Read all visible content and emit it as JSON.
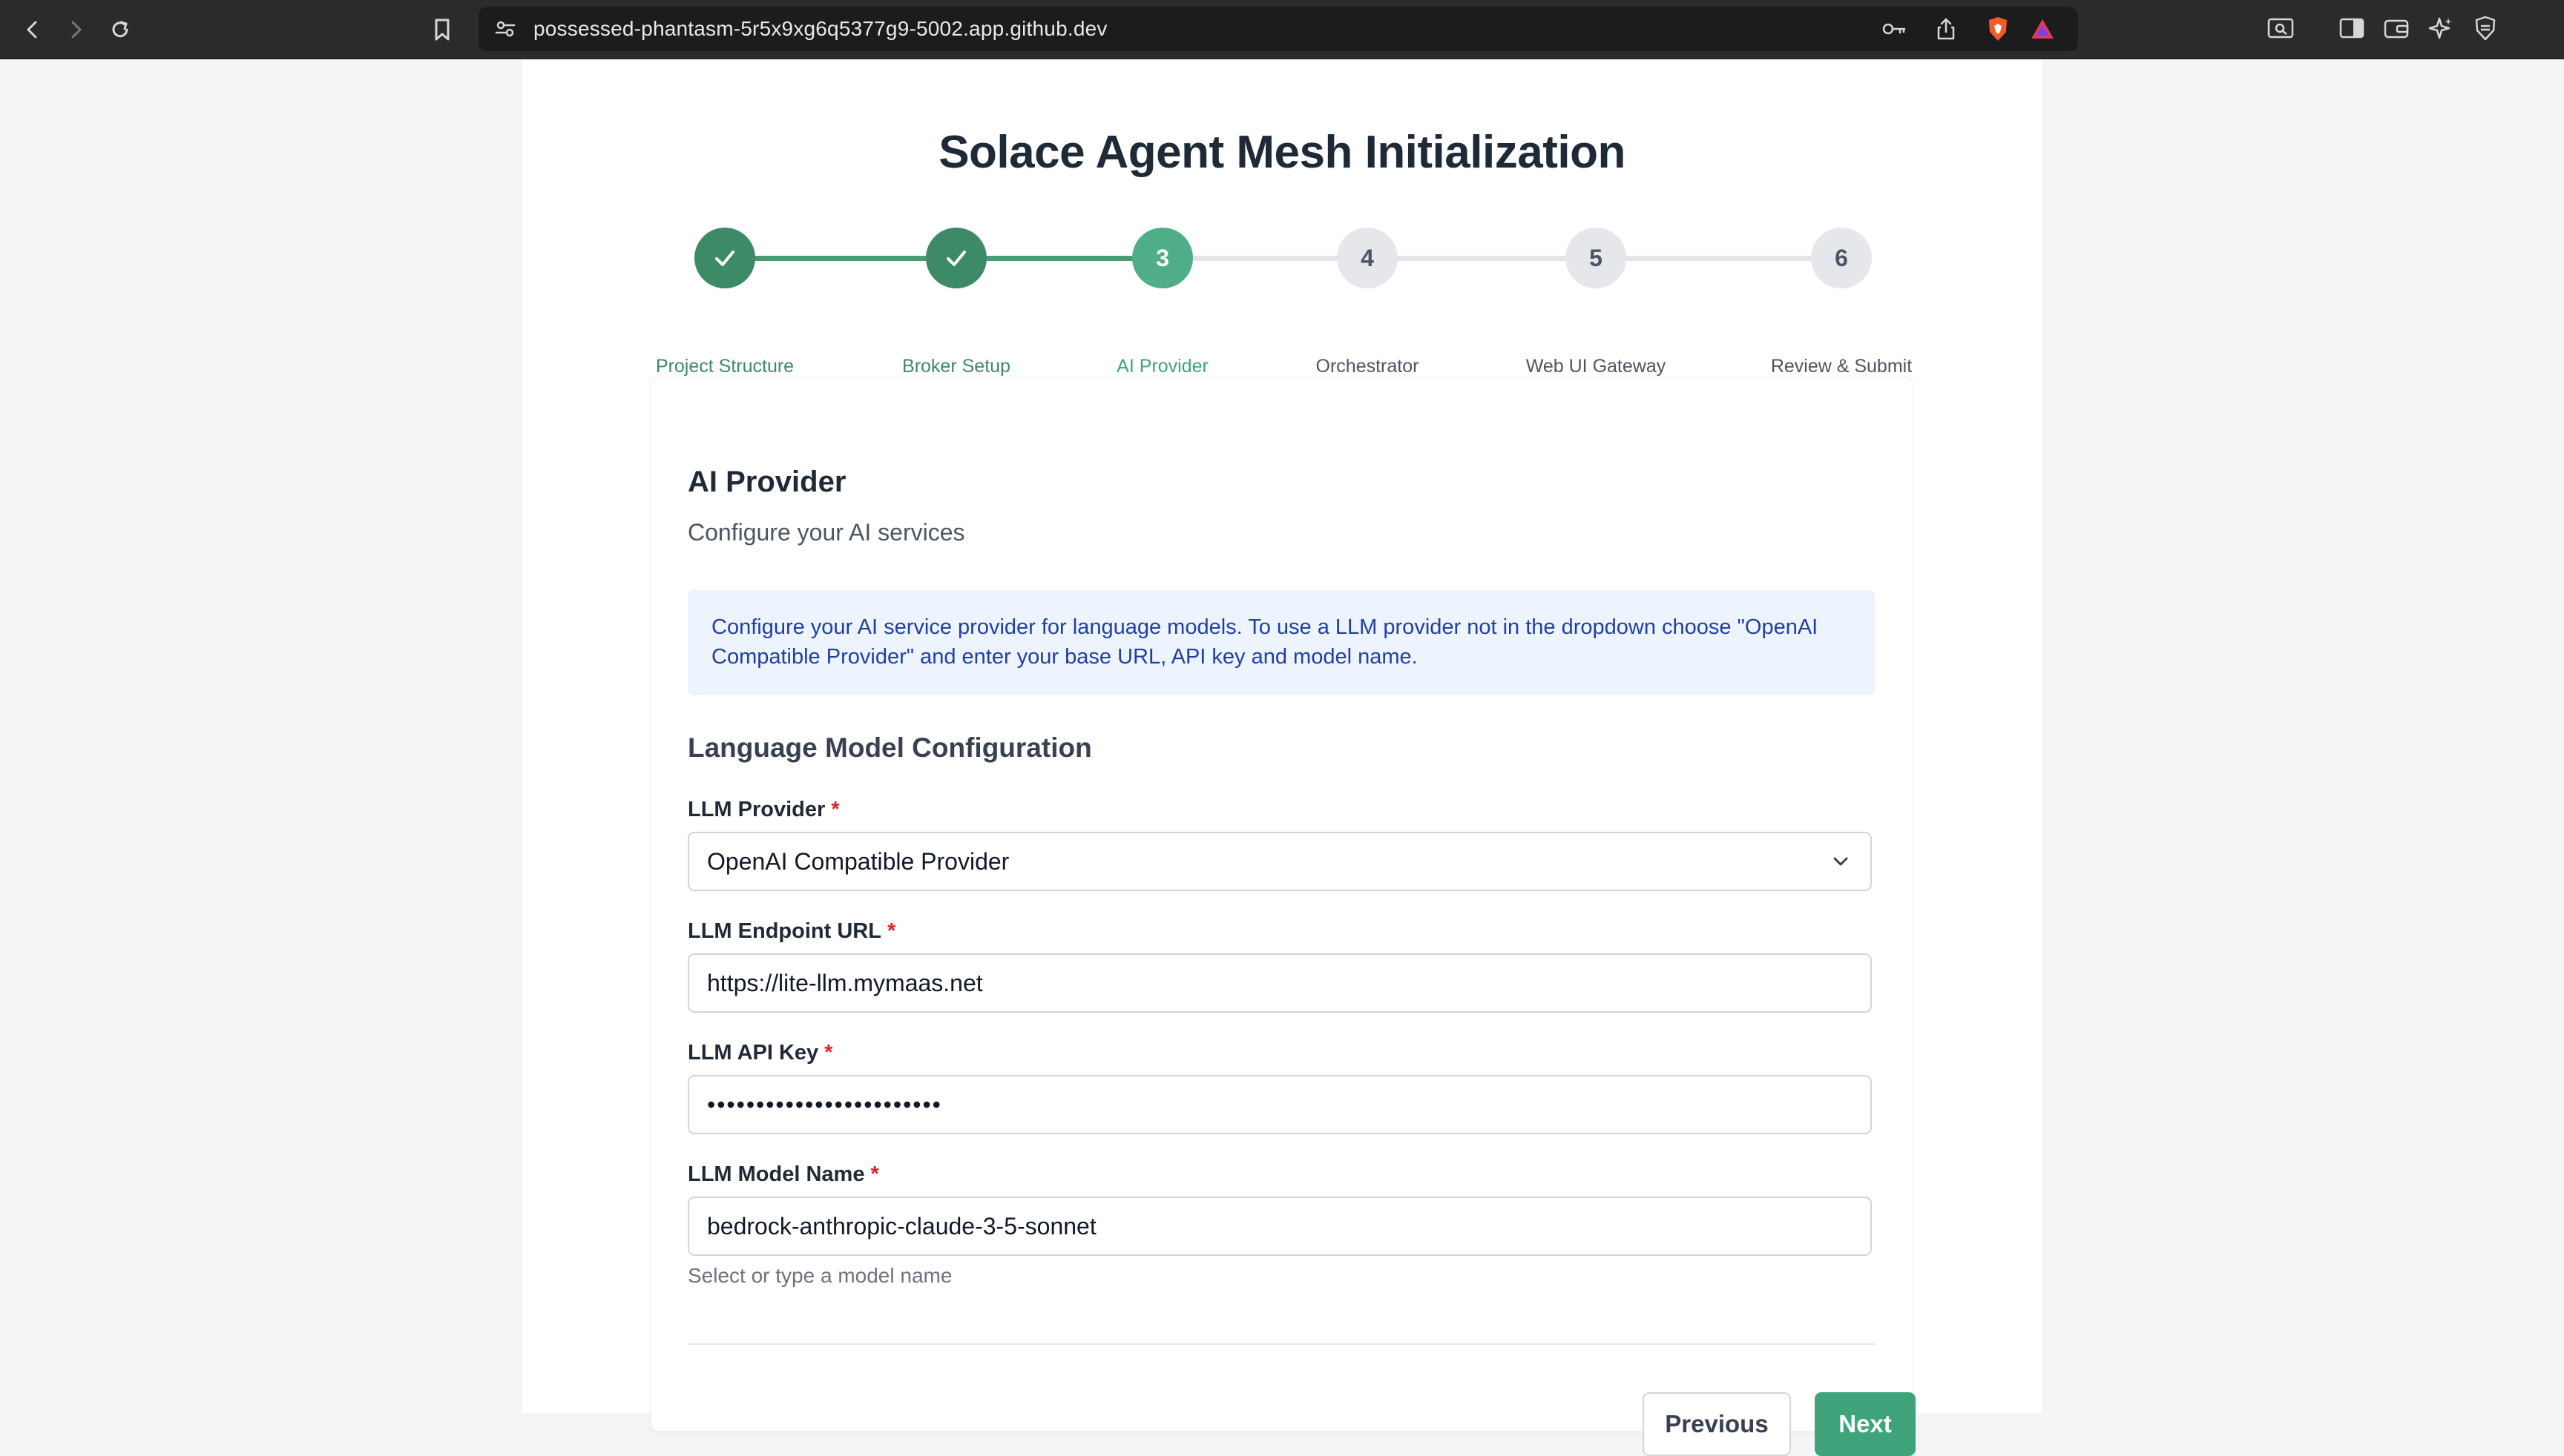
{
  "browser": {
    "url": "possessed-phantasm-5r5x9xg6q5377g9-5002.app.github.dev",
    "icons": [
      "back-icon",
      "forward-icon",
      "reload-icon",
      "bookmark-icon",
      "site-settings-icon",
      "key-icon",
      "share-icon",
      "brave-shields-icon",
      "brave-rewards-icon",
      "reader-mode-icon",
      "sidebar-icon",
      "wallet-icon",
      "leo-ai-icon",
      "vpn-icon"
    ]
  },
  "page": {
    "title": "Solace Agent Mesh Initialization"
  },
  "stepper": {
    "steps": [
      {
        "number": "1",
        "label": "Project Structure",
        "status": "completed"
      },
      {
        "number": "2",
        "label": "Broker Setup",
        "status": "completed"
      },
      {
        "number": "3",
        "label": "AI Provider",
        "status": "active"
      },
      {
        "number": "4",
        "label": "Orchestrator",
        "status": "pending"
      },
      {
        "number": "5",
        "label": "Web UI Gateway",
        "status": "pending"
      },
      {
        "number": "6",
        "label": "Review & Submit",
        "status": "pending"
      }
    ],
    "colors": {
      "completed": "#3d8a67",
      "active": "#4fae87",
      "pending": "#e5e7eb",
      "line_done": "#4a9a75",
      "line_pending": "#e2e4e8"
    }
  },
  "card": {
    "title": "AI Provider",
    "subtitle": "Configure your AI services",
    "info_text": "Configure your AI service provider for language models. To use a LLM provider not in the dropdown choose \"OpenAI Compatible Provider\" and enter your base URL, API key and model name.",
    "section_title": "Language Model Configuration",
    "fields": {
      "provider": {
        "label": "LLM Provider",
        "required": "*",
        "value": "OpenAI Compatible Provider"
      },
      "endpoint": {
        "label": "LLM Endpoint URL",
        "required": "*",
        "value": "https://lite-llm.mymaas.net"
      },
      "api_key": {
        "label": "LLM API Key",
        "required": "*",
        "value": "••••••••••••••••••••••••"
      },
      "model": {
        "label": "LLM Model Name",
        "required": "*",
        "value": "bedrock-anthropic-claude-3-5-sonnet",
        "hint": "Select or type a model name"
      }
    },
    "buttons": {
      "previous": "Previous",
      "next": "Next"
    },
    "accent_color": "#3fa47c"
  }
}
